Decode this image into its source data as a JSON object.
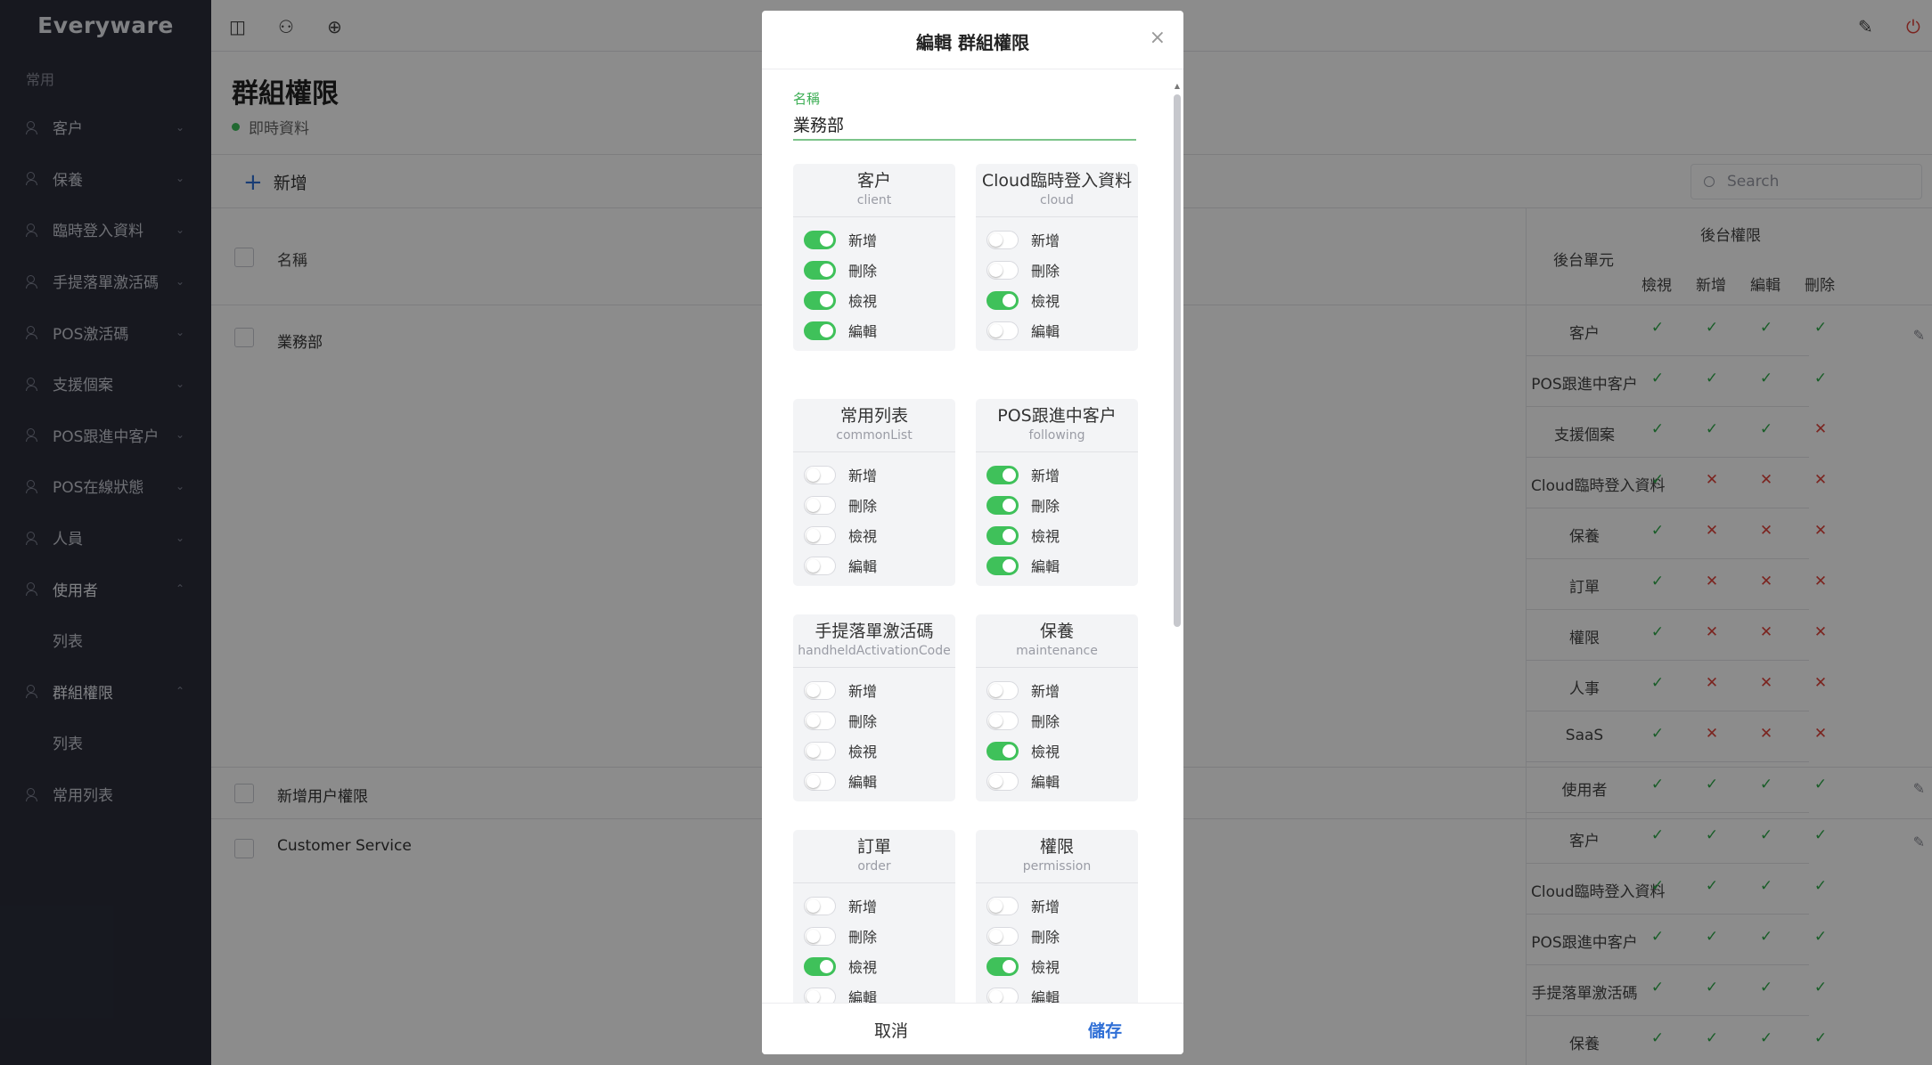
{
  "app": {
    "brand": "Everyware"
  },
  "sidebar": {
    "section": "常用",
    "items": [
      {
        "label": "客户"
      },
      {
        "label": "保養"
      },
      {
        "label": "臨時登入資料"
      },
      {
        "label": "手提落單激活碼"
      },
      {
        "label": "POS激活碼"
      },
      {
        "label": "支援個案"
      },
      {
        "label": "POS跟進中客户"
      },
      {
        "label": "POS在線狀態"
      },
      {
        "label": "人員"
      },
      {
        "label": "使用者"
      },
      {
        "label": "列表"
      },
      {
        "label": "群組權限"
      },
      {
        "label": "列表"
      },
      {
        "label": "常用列表"
      }
    ]
  },
  "page": {
    "title": "群組權限",
    "live_status": "即時資料"
  },
  "toolbar": {
    "add_label": "新增",
    "search_placeholder": "Search"
  },
  "table": {
    "headers": {
      "name": "名稱",
      "unit": "後台單元",
      "perm": "後台權限",
      "view": "檢視",
      "add": "新增",
      "edit": "編輯",
      "delete": "刪除"
    },
    "groups": [
      {
        "name": "業務部"
      },
      {
        "name": "新增用户權限"
      },
      {
        "name": "Customer Service"
      }
    ],
    "perm_rows": [
      {
        "unit": "客户",
        "marks": [
          "✓",
          "✓",
          "✓",
          "✓"
        ]
      },
      {
        "unit": "POS跟進中客户",
        "marks": [
          "✓",
          "✓",
          "✓",
          "✓"
        ]
      },
      {
        "unit": "支援個案",
        "marks": [
          "✓",
          "✓",
          "✓",
          "✕"
        ]
      },
      {
        "unit": "Cloud臨時登入資料",
        "marks": [
          "✓",
          "✕",
          "✕",
          "✕"
        ]
      },
      {
        "unit": "保養",
        "marks": [
          "✓",
          "✕",
          "✕",
          "✕"
        ]
      },
      {
        "unit": "訂單",
        "marks": [
          "✓",
          "✕",
          "✕",
          "✕"
        ]
      },
      {
        "unit": "權限",
        "marks": [
          "✓",
          "✕",
          "✕",
          "✕"
        ]
      },
      {
        "unit": "人事",
        "marks": [
          "✓",
          "✕",
          "✕",
          "✕"
        ]
      },
      {
        "unit": "SaaS",
        "marks": [
          "✓",
          "✕",
          "✕",
          "✕"
        ]
      },
      {
        "unit": "使用者",
        "marks": [
          "✓",
          "✓",
          "✓",
          "✓"
        ]
      },
      {
        "unit": "客户",
        "marks": [
          "✓",
          "✓",
          "✓",
          "✓"
        ]
      },
      {
        "unit": "Cloud臨時登入資料",
        "marks": [
          "✓",
          "✓",
          "✓",
          "✓"
        ]
      },
      {
        "unit": "POS跟進中客户",
        "marks": [
          "✓",
          "✓",
          "✓",
          "✓"
        ]
      },
      {
        "unit": "手提落單激活碼",
        "marks": [
          "✓",
          "✓",
          "✓",
          "✓"
        ]
      },
      {
        "unit": "保養",
        "marks": [
          "✓",
          "✓",
          "✓",
          "✓"
        ]
      }
    ]
  },
  "modal": {
    "title": "編輯 群組權限",
    "close": "×",
    "name_label": "名稱",
    "name_value": "業務部",
    "cancel_label": "取消",
    "save_label": "儲存",
    "cards": [
      {
        "title": "客户",
        "sub": "client",
        "toggles": [
          {
            "label": "新增",
            "on": true
          },
          {
            "label": "刪除",
            "on": true
          },
          {
            "label": "檢視",
            "on": true
          },
          {
            "label": "編輯",
            "on": true
          }
        ]
      },
      {
        "title": "Cloud臨時登入資料",
        "sub": "cloud",
        "toggles": [
          {
            "label": "新增",
            "on": false
          },
          {
            "label": "刪除",
            "on": false
          },
          {
            "label": "檢視",
            "on": true
          },
          {
            "label": "編輯",
            "on": false
          }
        ]
      },
      {
        "title": "常用列表",
        "sub": "commonList",
        "toggles": [
          {
            "label": "新增",
            "on": false
          },
          {
            "label": "刪除",
            "on": false
          },
          {
            "label": "檢視",
            "on": false
          },
          {
            "label": "編輯",
            "on": false
          }
        ]
      },
      {
        "title": "POS跟進中客户",
        "sub": "following",
        "toggles": [
          {
            "label": "新增",
            "on": true
          },
          {
            "label": "刪除",
            "on": true
          },
          {
            "label": "檢視",
            "on": true
          },
          {
            "label": "編輯",
            "on": true
          }
        ]
      },
      {
        "title": "手提落單激活碼",
        "sub": "handheldActivationCode",
        "toggles": [
          {
            "label": "新增",
            "on": false
          },
          {
            "label": "刪除",
            "on": false
          },
          {
            "label": "檢視",
            "on": false
          },
          {
            "label": "編輯",
            "on": false
          }
        ]
      },
      {
        "title": "保養",
        "sub": "maintenance",
        "toggles": [
          {
            "label": "新增",
            "on": false
          },
          {
            "label": "刪除",
            "on": false
          },
          {
            "label": "檢視",
            "on": true
          },
          {
            "label": "編輯",
            "on": false
          }
        ]
      },
      {
        "title": "訂單",
        "sub": "order",
        "toggles": [
          {
            "label": "新增",
            "on": false
          },
          {
            "label": "刪除",
            "on": false
          },
          {
            "label": "檢視",
            "on": true
          },
          {
            "label": "編輯",
            "on": false
          }
        ]
      },
      {
        "title": "權限",
        "sub": "permission",
        "toggles": [
          {
            "label": "新增",
            "on": false
          },
          {
            "label": "刪除",
            "on": false
          },
          {
            "label": "檢視",
            "on": true
          },
          {
            "label": "編輯",
            "on": false
          }
        ]
      }
    ]
  },
  "colors": {
    "sidebar_bg": "#2a2d3a",
    "toggle_on": "#3fc15a",
    "check": "#2eaa4a",
    "cross": "#e0423a",
    "accent": "#2f6fd6"
  }
}
